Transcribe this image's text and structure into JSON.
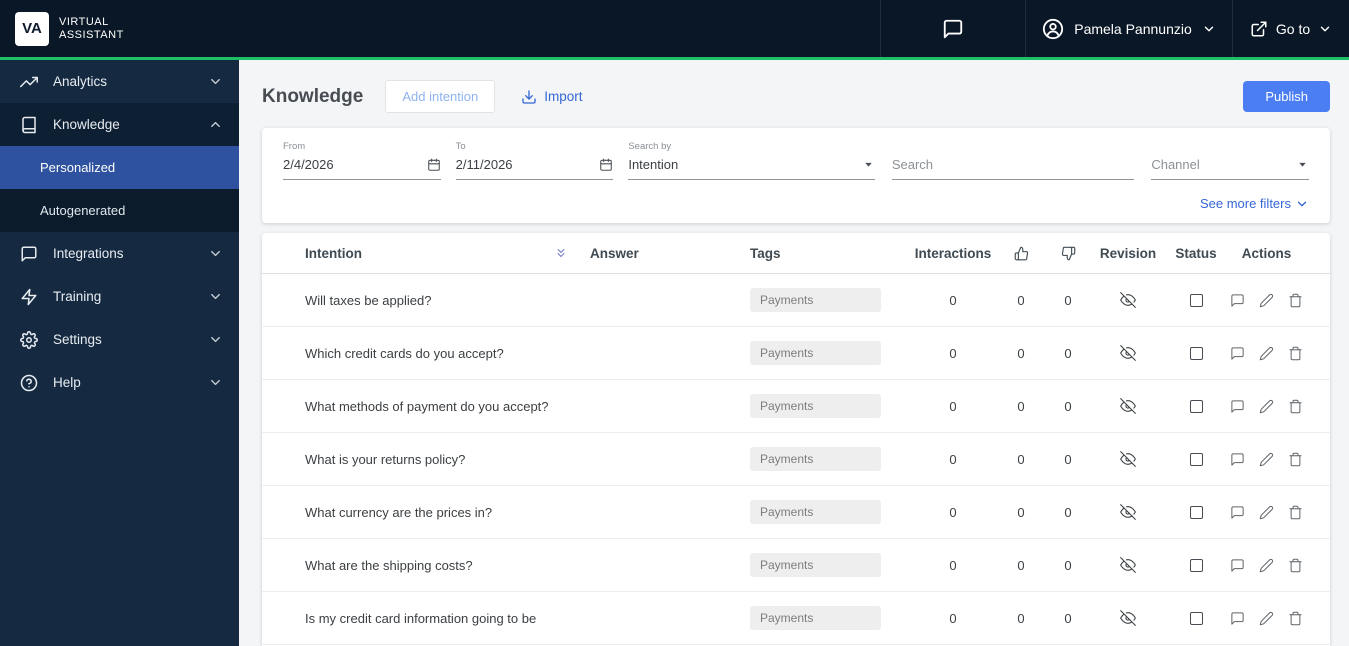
{
  "colors": {
    "accent_green": "#1fc065",
    "primary_blue": "#4c7ef3",
    "link_blue": "#3567d6",
    "nav_selected_blue": "#2e529f",
    "topbar_bg": "#0a1726",
    "sidebar_bg": "#152a41"
  },
  "topbar": {
    "logo": "VA",
    "brand_line1": "VIRTUAL",
    "brand_line2": "ASSISTANT",
    "user_name": "Pamela Pannunzio",
    "goto_label": "Go to"
  },
  "sidebar": {
    "analytics": "Analytics",
    "knowledge": "Knowledge",
    "personalized": "Personalized",
    "autogenerated": "Autogenerated",
    "integrations": "Integrations",
    "training": "Training",
    "settings": "Settings",
    "help": "Help"
  },
  "page": {
    "title": "Knowledge",
    "add_intention": "Add intention",
    "import": "Import",
    "publish": "Publish"
  },
  "filters": {
    "from_label": "From",
    "from_value": "2/4/2026",
    "to_label": "To",
    "to_value": "2/11/2026",
    "search_by_label": "Search by",
    "search_by_value": "Intention",
    "search_placeholder": "Search",
    "channel_placeholder": "Channel",
    "see_more_filters": "See more filters"
  },
  "table": {
    "headers": {
      "intention": "Intention",
      "answer": "Answer",
      "tags": "Tags",
      "interactions": "Interactions",
      "revision": "Revision",
      "status": "Status",
      "actions": "Actions"
    },
    "rows": [
      {
        "intention": "Will taxes be applied?",
        "tag": "Payments",
        "interactions": "0",
        "likes": "0",
        "dislikes": "0"
      },
      {
        "intention": "Which credit cards do you accept?",
        "tag": "Payments",
        "interactions": "0",
        "likes": "0",
        "dislikes": "0"
      },
      {
        "intention": "What methods of payment do you accept?",
        "tag": "Payments",
        "interactions": "0",
        "likes": "0",
        "dislikes": "0"
      },
      {
        "intention": "What is your returns policy?",
        "tag": "Payments",
        "interactions": "0",
        "likes": "0",
        "dislikes": "0"
      },
      {
        "intention": "What currency are the prices in?",
        "tag": "Payments",
        "interactions": "0",
        "likes": "0",
        "dislikes": "0"
      },
      {
        "intention": "What are the shipping costs?",
        "tag": "Payments",
        "interactions": "0",
        "likes": "0",
        "dislikes": "0"
      },
      {
        "intention": "Is my credit card information going to be",
        "tag": "Payments",
        "interactions": "0",
        "likes": "0",
        "dislikes": "0"
      }
    ]
  }
}
